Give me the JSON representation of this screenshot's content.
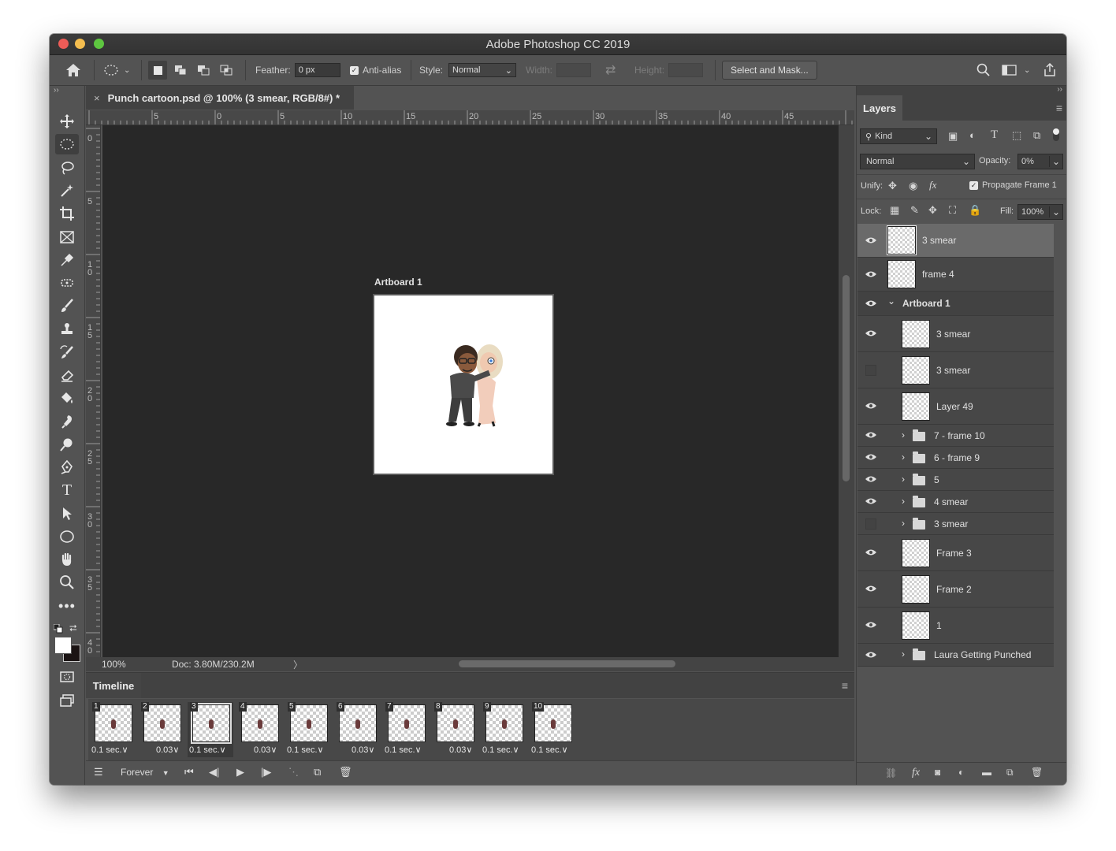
{
  "window": {
    "title": "Adobe Photoshop CC 2019"
  },
  "options": {
    "feather_label": "Feather:",
    "feather_value": "0 px",
    "antialias_label": "Anti-alias",
    "style_label": "Style:",
    "style_value": "Normal",
    "width_label": "Width:",
    "height_label": "Height:",
    "select_mask": "Select and Mask..."
  },
  "document": {
    "tab_title": "Punch cartoon.psd @ 100% (3 smear, RGB/8#) *",
    "artboard_label": "Artboard 1",
    "zoom": "100%",
    "doc_size": "Doc: 3.80M/230.2M"
  },
  "ruler": {
    "h": [
      "5",
      "0",
      "5",
      "10",
      "15",
      "20",
      "25",
      "30",
      "35",
      "40",
      "45"
    ],
    "v": [
      "0",
      "5",
      "1 0",
      "1 5",
      "2 0",
      "2 5",
      "3 0",
      "3 5",
      "4 0"
    ]
  },
  "timeline": {
    "tab": "Timeline",
    "frames": [
      {
        "num": "1",
        "delay": "0.1 sec.∨"
      },
      {
        "num": "2",
        "delay": "0.03∨"
      },
      {
        "num": "3",
        "delay": "0.1 sec.∨",
        "selected": true
      },
      {
        "num": "4",
        "delay": "0.03∨"
      },
      {
        "num": "5",
        "delay": "0.1 sec.∨"
      },
      {
        "num": "6",
        "delay": "0.03∨"
      },
      {
        "num": "7",
        "delay": "0.1 sec.∨"
      },
      {
        "num": "8",
        "delay": "0.03∨"
      },
      {
        "num": "9",
        "delay": "0.1 sec.∨"
      },
      {
        "num": "10",
        "delay": "0.1 sec.∨"
      }
    ],
    "loop": "Forever"
  },
  "layers_panel": {
    "tab": "Layers",
    "kind_label": "Kind",
    "blend_mode": "Normal",
    "opacity_label": "Opacity:",
    "opacity_value": "0%",
    "unify_label": "Unify:",
    "propagate_label": "Propagate Frame 1",
    "lock_label": "Lock:",
    "fill_label": "Fill:",
    "fill_value": "100%",
    "layers": [
      {
        "name": "3 smear",
        "type": "layer",
        "visible": true,
        "selected": true,
        "indent": 0
      },
      {
        "name": "frame 4",
        "type": "layer",
        "visible": true,
        "indent": 0
      },
      {
        "name": "Artboard 1",
        "type": "artboard",
        "visible": true,
        "indent": 0
      },
      {
        "name": "3 smear",
        "type": "layer",
        "visible": true,
        "indent": 1
      },
      {
        "name": "3 smear",
        "type": "layer",
        "visible": false,
        "indent": 1
      },
      {
        "name": "Layer 49",
        "type": "layer",
        "visible": true,
        "indent": 1
      },
      {
        "name": "7 - frame 10",
        "type": "group",
        "visible": true,
        "indent": 1
      },
      {
        "name": "6 - frame 9",
        "type": "group",
        "visible": true,
        "indent": 1
      },
      {
        "name": "5",
        "type": "group",
        "visible": true,
        "indent": 1
      },
      {
        "name": "4 smear",
        "type": "group",
        "visible": true,
        "indent": 1
      },
      {
        "name": "3 smear",
        "type": "group",
        "visible": false,
        "indent": 1
      },
      {
        "name": "Frame 3",
        "type": "layer",
        "visible": true,
        "indent": 1
      },
      {
        "name": "Frame 2",
        "type": "layer",
        "visible": true,
        "indent": 1
      },
      {
        "name": "1",
        "type": "layer",
        "visible": true,
        "indent": 1
      },
      {
        "name": "Laura Getting Punched",
        "type": "group",
        "visible": true,
        "indent": 1
      }
    ]
  }
}
